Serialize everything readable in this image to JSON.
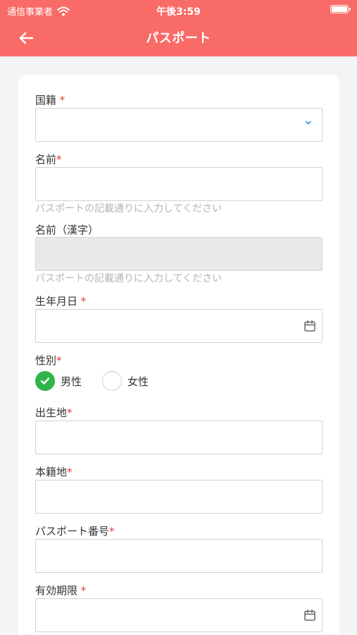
{
  "status_bar": {
    "carrier": "通信事業者",
    "time": "午後3:59"
  },
  "header": {
    "title": "パスポート"
  },
  "form": {
    "nationality": {
      "label": "国籍",
      "required_mark": "*",
      "value": ""
    },
    "name": {
      "label": "名前",
      "required_mark": "*",
      "value": "",
      "hint": "パスポートの記載通りに入力してください"
    },
    "name_kanji": {
      "label": "名前（漢字）",
      "value": "",
      "hint": "パスポートの記載通りに入力してください"
    },
    "birthdate": {
      "label": "生年月日",
      "required_mark": "*",
      "value": ""
    },
    "gender": {
      "label": "性別",
      "required_mark": "*",
      "options": [
        {
          "label": "男性",
          "selected": true
        },
        {
          "label": "女性",
          "selected": false
        }
      ]
    },
    "birthplace": {
      "label": "出生地",
      "required_mark": "*",
      "value": ""
    },
    "domicile": {
      "label": "本籍地",
      "required_mark": "*",
      "value": ""
    },
    "passport_number": {
      "label": "パスポート番号",
      "required_mark": "*",
      "value": ""
    },
    "expiry": {
      "label": "有効期限",
      "required_mark": "*",
      "value": ""
    }
  },
  "colors": {
    "header": "#f96b67",
    "required": "#e53935",
    "radio_checked": "#2db54a",
    "chevron": "#3a9be6"
  },
  "icons": {
    "back": "arrow-left-icon",
    "dropdown": "chevron-down-icon",
    "calendar": "calendar-icon",
    "check": "check-icon"
  }
}
